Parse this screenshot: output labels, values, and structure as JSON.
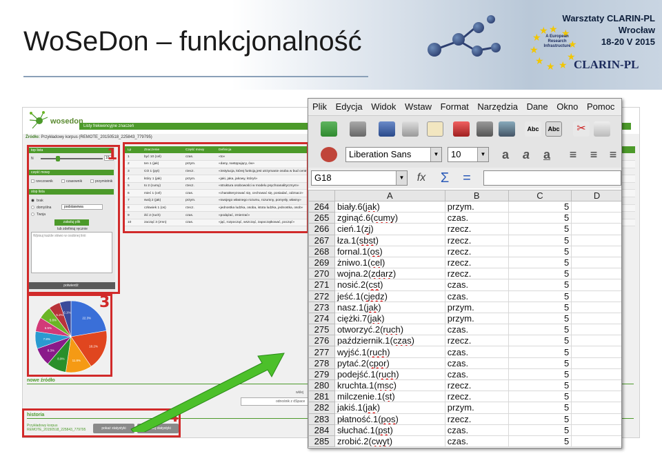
{
  "slide": {
    "title": "WoSeDon – funkcjonalność",
    "workshop": [
      "Warsztaty CLARIN-PL",
      "Wrocław",
      "18-20 V 2015"
    ],
    "clarin_logo": "CLARIN-PL",
    "eu_text": "A European Research Infrastructure"
  },
  "webapp": {
    "logo": "wosedon",
    "topbar_label": "Listy frekwencyjne znaczeń",
    "source_label": "Źródło:",
    "source_value": "Przykładowy korpus (REMOTE_20150518_225843_779795)",
    "panel": {
      "top_list": "top lista",
      "slider_value": "10",
      "pos_header": "część mowy",
      "pos_options": [
        "rzeczownik",
        "czasownik",
        "przymiotnik"
      ],
      "stoplist_header": "stop lista",
      "stoplist_options": [
        "brak",
        "domyślna",
        "Twoja"
      ],
      "stoplist_select": "podstawowa",
      "load_button": "załaduj plik",
      "load_or": "lub zdefiniuj ręcznie",
      "textarea_placeholder": "Wpisuj każde słowo w osobnej linii",
      "confirm_button": "potwierdź"
    },
    "table": {
      "headers": [
        "Lp",
        "Znaczenie",
        "Część mowy",
        "Definicja"
      ],
      "rows": [
        [
          "1",
          "być 10 (cel)",
          "czas.",
          "«to»"
        ],
        [
          "2",
          "ten 1 (jak)",
          "przym.",
          "«dany, następujący, ów»"
        ],
        [
          "3",
          "CO 1 (pyt)",
          "rzecz.",
          "«instytucja, której funkcją jest utrzymanie osoba w bud centralne, c.o., zład»"
        ],
        [
          "4",
          "który 1 (jak)",
          "przym.",
          "«jaki, jaka, jakowy, któryś»"
        ],
        [
          "5",
          "to 2 (cumy)",
          "rzecz.",
          "«struktura osobowości w modelu psychoanalitycznym»"
        ],
        [
          "6",
          "mieć 1 (cel)",
          "czas.",
          "«charakteryzować się, cechować się, posiadać, odznacz»"
        ],
        [
          "7",
          "swój 2 (jak)",
          "przym.",
          "«swojego własnego rozumu, rozumny, pomysły, własny»"
        ],
        [
          "8",
          "człowiek 1 (os)",
          "rzecz.",
          "«jednostka ludzka, osoba, istota ludzka, jednostka, osob»"
        ],
        [
          "9",
          "iść 2 (ruch)",
          "czas.",
          "«podążać, zmierzać»"
        ],
        [
          "10",
          "zacząć 3 (zmn)",
          "czas.",
          "«jąć, rozpocząć, wszcząć, zapoczątkować, począć»"
        ]
      ]
    },
    "new_source": "nowe źródło",
    "paste_label": "wklej",
    "paste_value": "odnośnik z dSpace",
    "history": "historia",
    "history_corpus": "Przykładowy korpus",
    "history_id": "REMOTE_20150518_225843_779795",
    "btn_show_stats": "pokaż statystyki",
    "btn_load_stats": "załaduj statystyki"
  },
  "pie": {
    "labels": [
      "22.3%",
      "18.2%",
      "11.8%",
      "8.9%",
      "8.3%",
      "7.8%",
      "6.5%",
      "5.8%",
      "5.2%",
      "5.1%"
    ],
    "colors": [
      "#3a6fd8",
      "#e0461f",
      "#f59a14",
      "#2a8f2a",
      "#8a1a8a",
      "#2a9ad0",
      "#d23a78",
      "#6bb526",
      "#b8333a",
      "#3a4a9a"
    ],
    "values": [
      22.3,
      18.2,
      11.8,
      8.9,
      8.3,
      7.8,
      6.5,
      5.8,
      5.2,
      5.1
    ]
  },
  "annotations": [
    "1",
    "3",
    "4"
  ],
  "calc": {
    "menu": [
      "Plik",
      "Edycja",
      "Widok",
      "Wstaw",
      "Format",
      "Narzędzia",
      "Dane",
      "Okno",
      "Pomoc"
    ],
    "font": "Liberation Sans",
    "size": "10",
    "namebox": "G18",
    "columns": [
      "A",
      "B",
      "C",
      "D"
    ],
    "rows": [
      [
        "264",
        "biały.6(jak)",
        "przym.",
        "5"
      ],
      [
        "265",
        "zginąć.6(cumy)",
        "czas.",
        "5"
      ],
      [
        "266",
        "cień.1(zj)",
        "rzecz.",
        "5"
      ],
      [
        "267",
        "łza.1(sbst)",
        "rzecz.",
        "5"
      ],
      [
        "268",
        "fornal.1(os)",
        "rzecz.",
        "5"
      ],
      [
        "269",
        "żniwo.1(cel)",
        "rzecz.",
        "5"
      ],
      [
        "270",
        "wojna.2(zdarz)",
        "rzecz.",
        "5"
      ],
      [
        "271",
        "nosić.2(cst)",
        "czas.",
        "5"
      ],
      [
        "272",
        "jeść.1(cjedz)",
        "czas.",
        "5"
      ],
      [
        "273",
        "nasz.1(jak)",
        "przym.",
        "5"
      ],
      [
        "274",
        "ciężki.7(jak)",
        "przym.",
        "5"
      ],
      [
        "275",
        "otworzyć.2(ruch)",
        "czas.",
        "5"
      ],
      [
        "276",
        "październik.1(czas)",
        "rzecz.",
        "5"
      ],
      [
        "277",
        "wyjść.1(ruch)",
        "czas.",
        "5"
      ],
      [
        "278",
        "pytać.2(cpor)",
        "czas.",
        "5"
      ],
      [
        "279",
        "podejść.1(ruch)",
        "czas.",
        "5"
      ],
      [
        "280",
        "kruchta.1(msc)",
        "rzecz.",
        "5"
      ],
      [
        "281",
        "milczenie.1(st)",
        "rzecz.",
        "5"
      ],
      [
        "282",
        "jakiś.1(jak)",
        "przym.",
        "5"
      ],
      [
        "283",
        "płatność.1(pos)",
        "rzecz.",
        "5"
      ],
      [
        "284",
        "słuchać.1(pst)",
        "czas.",
        "5"
      ],
      [
        "285",
        "zrobić.2(cwyt)",
        "czas.",
        "5"
      ]
    ]
  }
}
